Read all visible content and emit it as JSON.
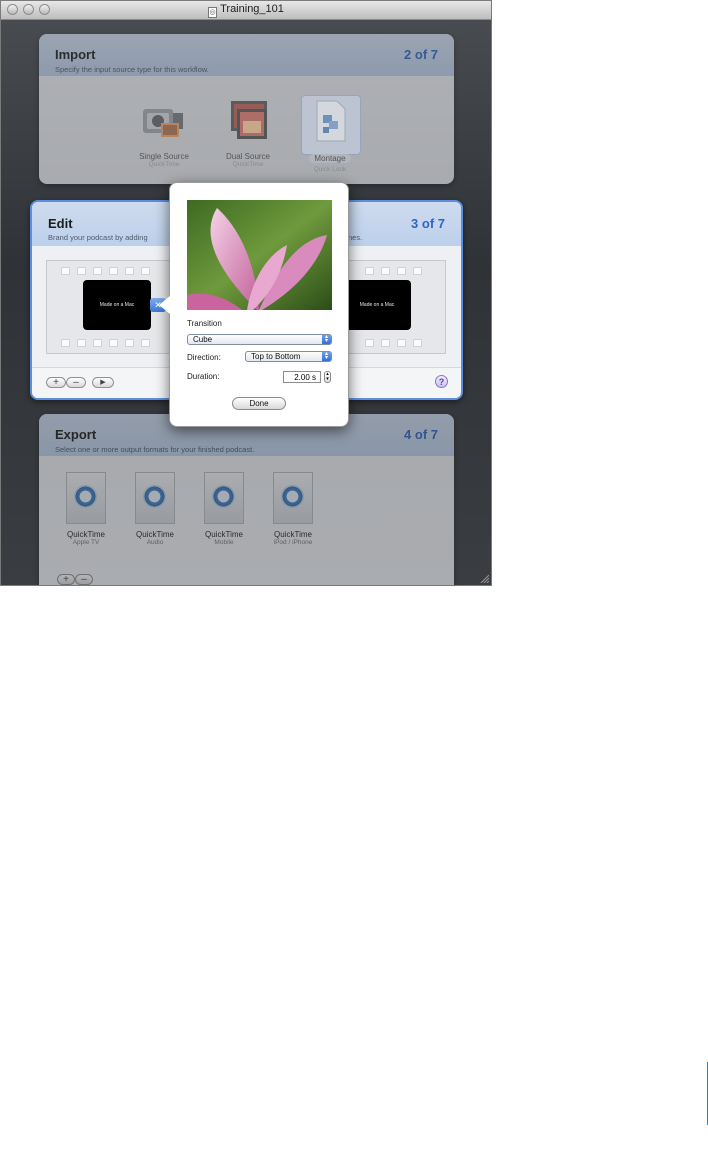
{
  "window": {
    "title": "Training_101"
  },
  "import": {
    "title": "Import",
    "subtitle": "Specify the input source type for this workflow.",
    "step": "2 of 7",
    "options": [
      {
        "label": "Single Source",
        "sub": "QuickTime",
        "icon": "camcorder-icon"
      },
      {
        "label": "Dual Source",
        "sub": "QuickTime",
        "icon": "dual-screen-icon"
      },
      {
        "label": "Montage",
        "sub": "Quick Look",
        "icon": "montage-document-icon",
        "selected": true
      }
    ]
  },
  "edit": {
    "title": "Edit",
    "subtitle_left": "Brand your podcast by adding",
    "subtitle_right": "nes.",
    "step": "3 of 7",
    "clips": [
      "Made on a Mac",
      "Made on a Mac"
    ],
    "toolbar": {
      "add": "+",
      "remove": "–",
      "play": "▶",
      "help": "?"
    }
  },
  "transition_popover": {
    "transition_label": "Transition",
    "transition_value": "Cube",
    "direction_label": "Direction:",
    "direction_value": "Top to Bottom",
    "duration_label": "Duration:",
    "duration_value": "2.00 s",
    "done_label": "Done"
  },
  "export": {
    "title": "Export",
    "subtitle": "Select one or more output formats for your finished podcast.",
    "step": "4 of 7",
    "formats": [
      {
        "label": "QuickTime",
        "sub": "Apple TV"
      },
      {
        "label": "QuickTime",
        "sub": "Audio"
      },
      {
        "label": "QuickTime",
        "sub": "Mobile"
      },
      {
        "label": "QuickTime",
        "sub": "iPod / iPhone"
      }
    ],
    "toolbar": {
      "add": "+",
      "remove": "–"
    }
  }
}
